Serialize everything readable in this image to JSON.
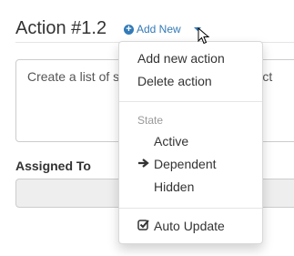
{
  "header": {
    "title": "Action #1.2",
    "add_new_label": "Add New"
  },
  "form": {
    "description_value": "Create a list of s",
    "description_tail": "ontact",
    "assigned_label": "Assigned To",
    "assigned_value": ""
  },
  "menu": {
    "items": [
      {
        "label": "Add new action"
      },
      {
        "label": "Delete action"
      }
    ],
    "state_header": "State",
    "state_items": [
      {
        "label": "Active",
        "selected": false
      },
      {
        "label": "Dependent",
        "selected": true
      },
      {
        "label": "Hidden",
        "selected": false
      }
    ],
    "auto_update_label": "Auto Update",
    "auto_update_checked": true,
    "selected_marker": "arrow-right-icon"
  },
  "colors": {
    "link": "#337ab7",
    "text": "#333333",
    "muted": "#999999",
    "border": "#cccccc",
    "disabled_bg": "#eeeeee"
  }
}
